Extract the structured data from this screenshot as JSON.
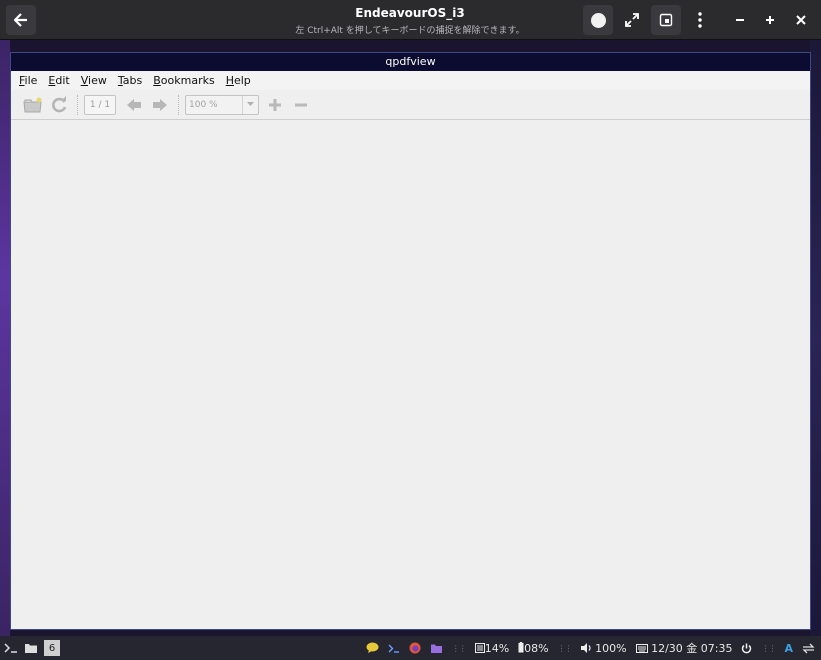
{
  "vm": {
    "title": "EndeavourOS_i3",
    "subtitle": "左 Ctrl+Alt を押してキーボードの捕捉を解除できます。"
  },
  "app": {
    "title": "qpdfview",
    "menu": [
      {
        "key": "F",
        "rest": "ile"
      },
      {
        "key": "E",
        "rest": "dit"
      },
      {
        "key": "V",
        "rest": "iew"
      },
      {
        "key": "T",
        "rest": "abs"
      },
      {
        "key": "B",
        "rest": "ookmarks"
      },
      {
        "key": "H",
        "rest": "elp"
      }
    ],
    "toolbar": {
      "page": "1 / 1",
      "zoom": "100 %"
    }
  },
  "statusbar": {
    "workspace": "6",
    "memory": "14%",
    "battery": "08%",
    "volume": "100%",
    "clock": "12/30 金 07:35",
    "lang": "A"
  },
  "colors": {
    "accent_title": "#0c0c30",
    "window_border": "#3d4a8a"
  }
}
